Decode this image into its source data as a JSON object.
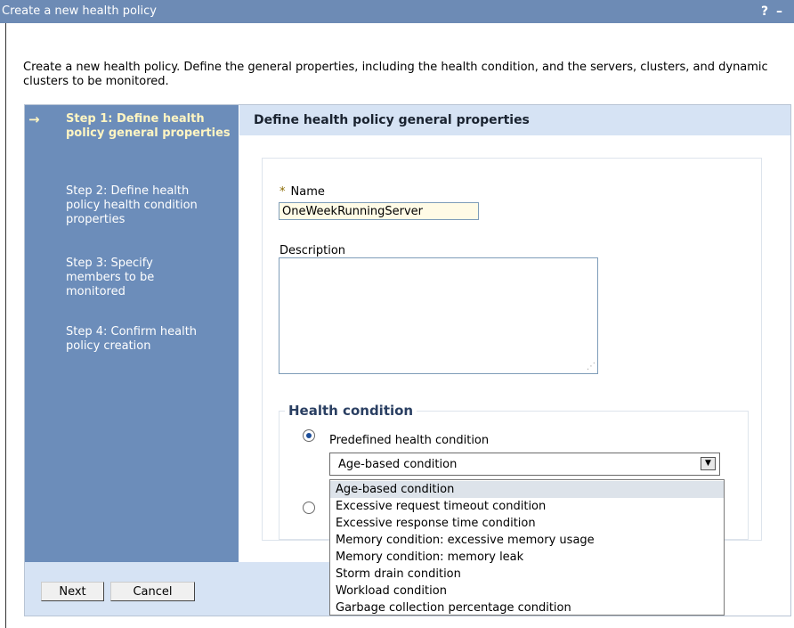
{
  "window": {
    "title": "Create a new health policy",
    "help": "?",
    "min": "–"
  },
  "intro": "Create a new health policy. Define the general properties, including the health condition, and the servers, clusters, and dynamic clusters to be monitored.",
  "steps": [
    {
      "label": "Step 1: Define health policy general properties",
      "current": true
    },
    {
      "label": "Step 2: Define health policy health condition properties"
    },
    {
      "label": "Step 3: Specify members to be monitored"
    },
    {
      "label": "Step 4: Confirm health policy creation"
    }
  ],
  "header": {
    "title": "Define health policy general properties"
  },
  "form": {
    "required_marker": "*",
    "name_label": "Name",
    "name_value": "OneWeekRunningServer",
    "description_label": "Description"
  },
  "health": {
    "legend": "Health condition",
    "predefined_label": "Predefined health condition",
    "selected": "Age-based condition",
    "options": [
      "Age-based condition",
      "Excessive request timeout condition",
      "Excessive response time condition",
      "Memory condition: excessive memory usage",
      "Memory condition: memory leak",
      "Storm drain condition",
      "Workload condition",
      "Garbage collection percentage condition"
    ]
  },
  "buttons": {
    "next": "Next",
    "cancel": "Cancel"
  }
}
